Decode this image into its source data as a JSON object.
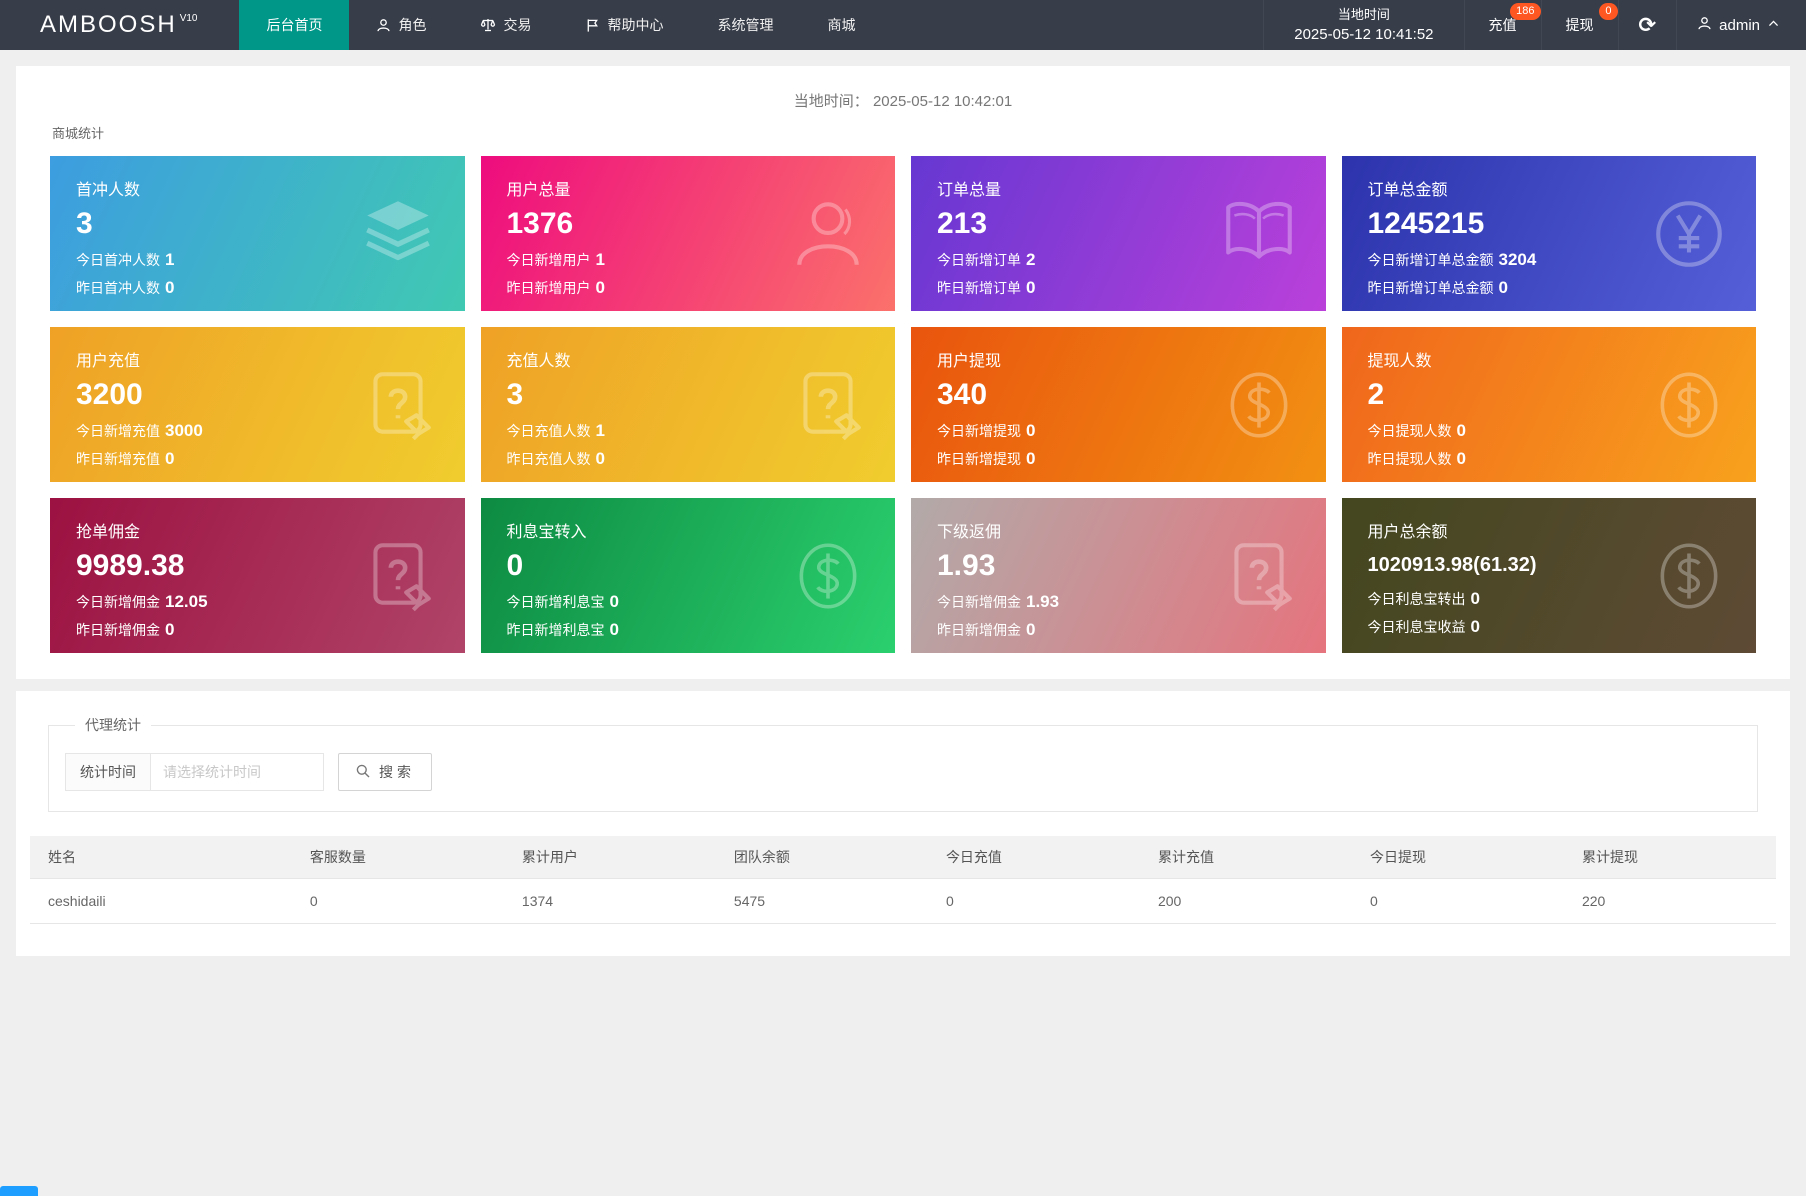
{
  "navbar": {
    "logo": "AMBOOSH",
    "logo_version": "V10",
    "menu": [
      {
        "label": "后台首页",
        "icon": "",
        "active": true
      },
      {
        "label": "角色",
        "icon": "person-icon",
        "active": false
      },
      {
        "label": "交易",
        "icon": "scales-icon",
        "active": false
      },
      {
        "label": "帮助中心",
        "icon": "flag-icon",
        "active": false
      },
      {
        "label": "系统管理",
        "icon": "",
        "active": false
      },
      {
        "label": "商城",
        "icon": "",
        "active": false
      }
    ],
    "local_time_label": "当地时间",
    "local_time_value": "2025-05-12 10:41:52",
    "recharge": {
      "label": "充值",
      "badge": "186"
    },
    "withdraw": {
      "label": "提现",
      "badge": "0"
    },
    "refresh_glyph": "⟳",
    "user": "admin",
    "badge_color": "#ff5722",
    "active_color": "#009688"
  },
  "overview": {
    "time_label": "当地时间：",
    "time_value": "2025-05-12 10:42:01",
    "section_title": "商城统计",
    "cards": [
      {
        "title": "首冲人数",
        "value": "3",
        "line1": {
          "label": "今日首冲人数",
          "value": "1"
        },
        "line2": {
          "label": "昨日首冲人数",
          "value": "0"
        },
        "icon": "layers-icon",
        "colors": [
          "#3d9de0",
          "#40c9b2"
        ],
        "small": false
      },
      {
        "title": "用户总量",
        "value": "1376",
        "line1": {
          "label": "今日新增用户",
          "value": "1"
        },
        "line2": {
          "label": "昨日新增用户",
          "value": "0"
        },
        "icon": "user-icon",
        "colors": [
          "#ee0c7e",
          "#fb716b"
        ],
        "small": false
      },
      {
        "title": "订单总量",
        "value": "213",
        "line1": {
          "label": "今日新增订单",
          "value": "2"
        },
        "line2": {
          "label": "昨日新增订单",
          "value": "0"
        },
        "icon": "book-icon",
        "colors": [
          "#6637d2",
          "#bb40da"
        ],
        "small": false
      },
      {
        "title": "订单总金额",
        "value": "1245215",
        "line1": {
          "label": "今日新增订单总金额",
          "value": "3204"
        },
        "line2": {
          "label": "昨日新增订单总金额",
          "value": "0"
        },
        "icon": "yen-icon",
        "colors": [
          "#2c33ac",
          "#5560d8"
        ],
        "small": false
      },
      {
        "title": "用户充值",
        "value": "3200",
        "line1": {
          "label": "今日新增充值",
          "value": "3000"
        },
        "line2": {
          "label": "昨日新增充值",
          "value": "0"
        },
        "icon": "doc-question-icon",
        "colors": [
          "#efa126",
          "#f0cd2e"
        ],
        "small": false
      },
      {
        "title": "充值人数",
        "value": "3",
        "line1": {
          "label": "今日充值人数",
          "value": "1"
        },
        "line2": {
          "label": "昨日充值人数",
          "value": "0"
        },
        "icon": "doc-question-icon",
        "colors": [
          "#efa126",
          "#f0cd2e"
        ],
        "small": false
      },
      {
        "title": "用户提现",
        "value": "340",
        "line1": {
          "label": "今日新增提现",
          "value": "0"
        },
        "line2": {
          "label": "昨日新增提现",
          "value": "0"
        },
        "icon": "dollar-icon",
        "colors": [
          "#e9540e",
          "#f29112"
        ],
        "small": false
      },
      {
        "title": "提现人数",
        "value": "2",
        "line1": {
          "label": "今日提现人数",
          "value": "0"
        },
        "line2": {
          "label": "昨日提现人数",
          "value": "0"
        },
        "icon": "dollar-icon",
        "colors": [
          "#f0661c",
          "#f8a21d"
        ],
        "small": false
      },
      {
        "title": "抢单佣金",
        "value": "9989.38",
        "line1": {
          "label": "今日新增佣金",
          "value": "12.05"
        },
        "line2": {
          "label": "昨日新增佣金",
          "value": "0"
        },
        "icon": "doc-question-icon",
        "colors": [
          "#9c1141",
          "#b04468"
        ],
        "small": false
      },
      {
        "title": "利息宝转入",
        "value": "0",
        "line1": {
          "label": "今日新增利息宝",
          "value": "0"
        },
        "line2": {
          "label": "昨日新增利息宝",
          "value": "0"
        },
        "icon": "dollar-icon",
        "colors": [
          "#0d8a42",
          "#2bd06e"
        ],
        "small": false
      },
      {
        "title": "下级返佣",
        "value": "1.93",
        "line1": {
          "label": "今日新增佣金",
          "value": "1.93"
        },
        "line2": {
          "label": "昨日新增佣金",
          "value": "0"
        },
        "icon": "doc-question-icon",
        "colors": [
          "#b2aaa9",
          "#e5747e"
        ],
        "small": false
      },
      {
        "title": "用户总余额",
        "value": "1020913.98(61.32)",
        "line1": {
          "label": "今日利息宝转出",
          "value": "0"
        },
        "line2": {
          "label": "今日利息宝收益",
          "value": "0"
        },
        "icon": "dollar-icon",
        "colors": [
          "#43471f",
          "#5e4a35"
        ],
        "small": true
      }
    ]
  },
  "agent": {
    "section_title": "代理统计",
    "filter_label": "统计时间",
    "filter_placeholder": "请选择统计时间",
    "search_label": "搜索",
    "table": {
      "headers": [
        "姓名",
        "客服数量",
        "累计用户",
        "团队余额",
        "今日充值",
        "累计充值",
        "今日提现",
        "累计提现"
      ],
      "rows": [
        [
          "ceshidaili",
          "0",
          "1374",
          "5475",
          "0",
          "200",
          "0",
          "220"
        ]
      ]
    }
  }
}
